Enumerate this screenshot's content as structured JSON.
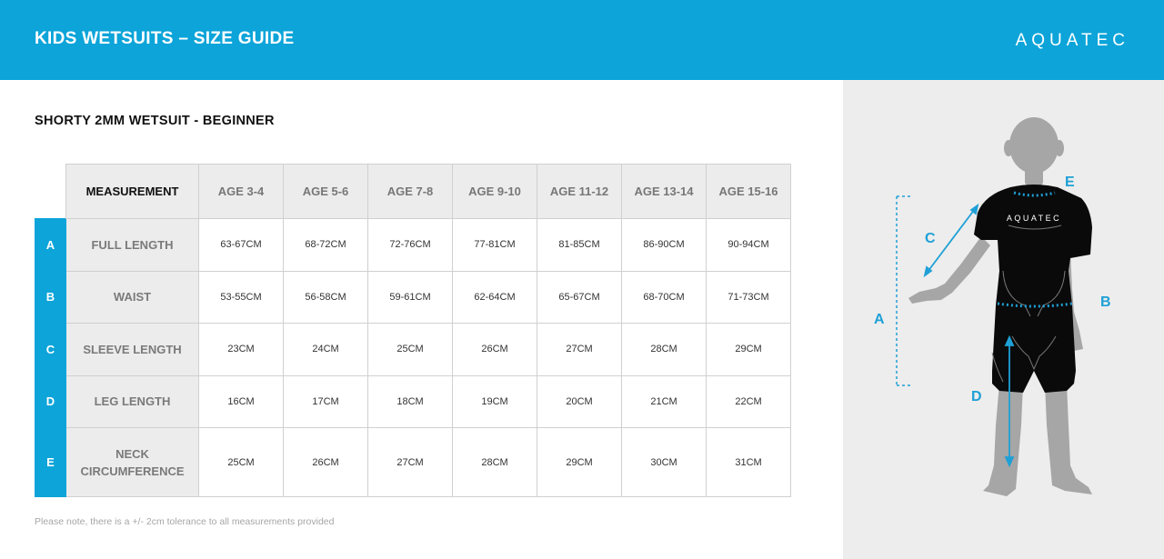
{
  "header": {
    "title": "KIDS WETSUITS – SIZE GUIDE",
    "brand": "AQUATEC"
  },
  "section_title": "SHORTY 2MM WETSUIT - BEGINNER",
  "table": {
    "measurement_header": "MEASUREMENT",
    "ages": [
      "AGE 3-4",
      "AGE 5-6",
      "AGE 7-8",
      "AGE 9-10",
      "AGE 11-12",
      "AGE 13-14",
      "AGE 15-16"
    ],
    "rows": [
      {
        "letter": "A",
        "label": "FULL LENGTH",
        "values": [
          "63-67CM",
          "68-72CM",
          "72-76CM",
          "77-81CM",
          "81-85CM",
          "86-90CM",
          "90-94CM"
        ]
      },
      {
        "letter": "B",
        "label": "WAIST",
        "values": [
          "53-55CM",
          "56-58CM",
          "59-61CM",
          "62-64CM",
          "65-67CM",
          "68-70CM",
          "71-73CM"
        ]
      },
      {
        "letter": "C",
        "label": "SLEEVE LENGTH",
        "values": [
          "23CM",
          "24CM",
          "25CM",
          "26CM",
          "27CM",
          "28CM",
          "29CM"
        ]
      },
      {
        "letter": "D",
        "label": "LEG LENGTH",
        "values": [
          "16CM",
          "17CM",
          "18CM",
          "19CM",
          "20CM",
          "21CM",
          "22CM"
        ]
      },
      {
        "letter": "E",
        "label_line1": "NECK",
        "label_line2": "CIRCUMFERENCE",
        "values": [
          "25CM",
          "26CM",
          "27CM",
          "28CM",
          "29CM",
          "30CM",
          "31CM"
        ]
      }
    ]
  },
  "note": "Please note, there is a +/- 2cm tolerance to all measurements provided",
  "figure": {
    "suit_brand": "AQUATEC",
    "labels": {
      "a": "A",
      "b": "B",
      "c": "C",
      "d": "D",
      "e": "E"
    }
  },
  "colors": {
    "accent": "#0ca4d9",
    "header_cell": "#ececec",
    "panel": "#ededed",
    "suit": "#0a0a0a",
    "skin": "#a6a6a6"
  }
}
